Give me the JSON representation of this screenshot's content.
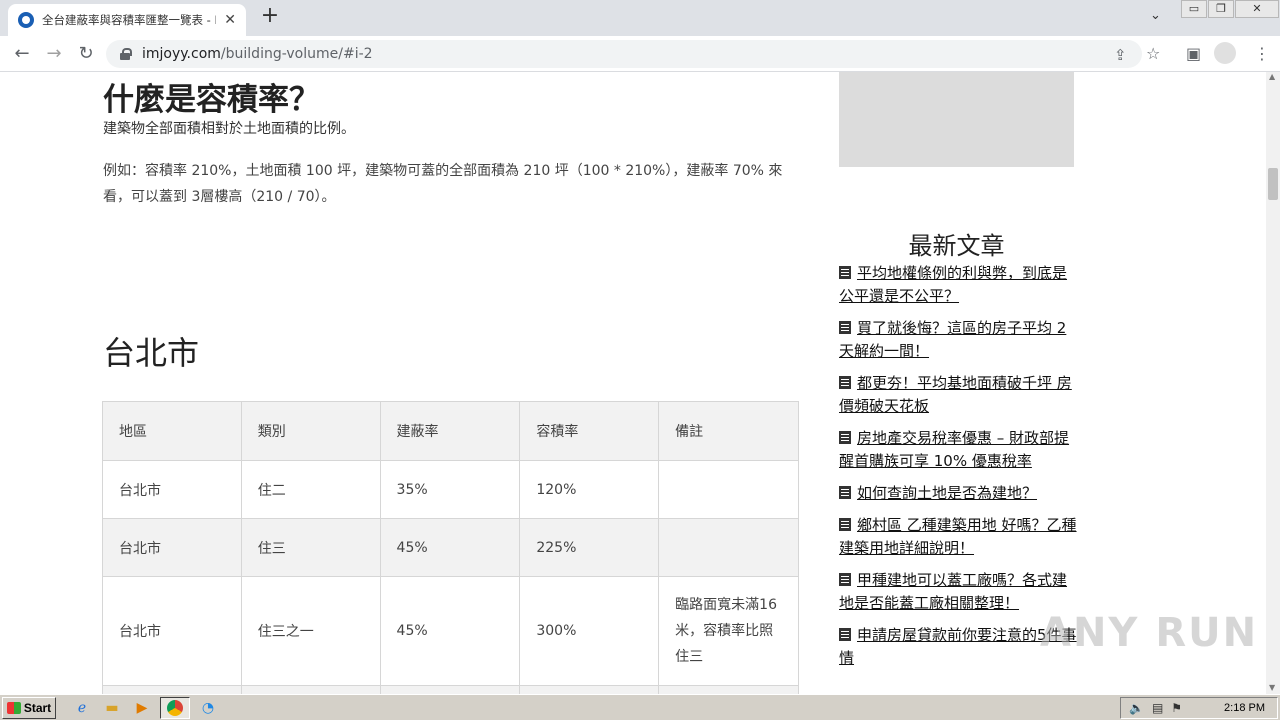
{
  "browser": {
    "tab_title": "全台建蔽率與容積率匯整一覽表 - I",
    "tab_close": "✕",
    "new_tab": "+",
    "url_host": "imjoyy.com",
    "url_path": "/building-volume/#i-2",
    "minimize": "▭",
    "restore": "❐",
    "close": "✕"
  },
  "article": {
    "heading": "什麼是容積率？",
    "definition": "建築物全部面積相對於土地面積的比例。",
    "example": "例如：容積率 210%，土地面積 100 坪，建築物可蓋的全部面積為 210 坪（100 * 210%），建蔽率 70% 來看，可以蓋到 3層樓高（210 / 70）。",
    "city_heading": "台北市"
  },
  "table": {
    "headers": [
      "地區",
      "類別",
      "建蔽率",
      "容積率",
      "備註"
    ],
    "rows": [
      [
        "台北市",
        "住二",
        "35%",
        "120%",
        ""
      ],
      [
        "台北市",
        "住三",
        "45%",
        "225%",
        ""
      ],
      [
        "台北市",
        "住三之一",
        "45%",
        "300%",
        "臨路面寬未滿16米，容積率比照住三"
      ]
    ]
  },
  "sidebar": {
    "title": "最新文章",
    "posts": [
      "平均地權條例的利與弊，到底是公平還是不公平？",
      "買了就後悔？這區的房子平均 2 天解約一間！",
      "都更夯！平均基地面積破千坪 房價頻破天花板",
      "房地產交易稅率優惠 – 財政部提醒首購族可享 10% 優惠稅率",
      "如何查詢土地是否為建地？",
      "鄉村區 乙種建築用地 好嗎？乙種建築用地詳細說明！",
      "甲種建地可以蓋工廠嗎？各式建地是否能蓋工廠相關整理！",
      "申請房屋貸款前你要注意的5件事情"
    ]
  },
  "watermark": "ANY RUN",
  "taskbar": {
    "start": "Start",
    "clock": "2:18 PM"
  },
  "icons": {
    "back": "back-arrow-icon",
    "forward": "forward-arrow-icon",
    "reload": "reload-icon",
    "share": "share-icon",
    "star": "star-icon",
    "sidepanel": "side-panel-icon",
    "profile": "profile-icon",
    "menu": "kebab-menu-icon"
  }
}
